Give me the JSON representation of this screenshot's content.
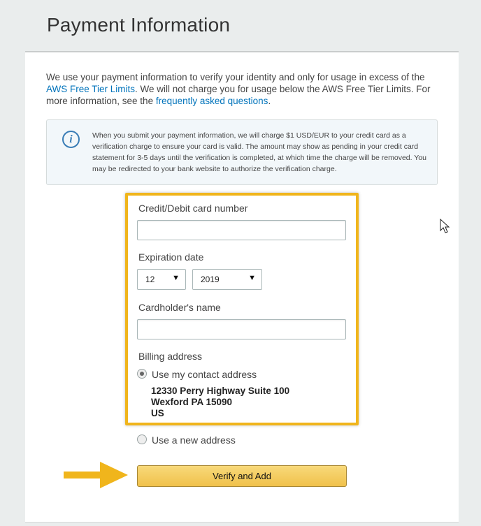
{
  "page": {
    "title": "Payment Information"
  },
  "intro": {
    "text_1": "We use your payment information to verify your identity and only for usage in excess of the ",
    "link_free_tier": "AWS Free Tier Limits",
    "text_2": ". We will not charge you for usage below the AWS Free Tier Limits. For more information, see the ",
    "link_faq": "frequently asked questions",
    "text_3": "."
  },
  "notice": {
    "icon": "i",
    "text": "When you submit your payment information, we will charge $1 USD/EUR to your credit card as a verification charge to ensure your card is valid. The amount may show as pending in your credit card statement for 3-5 days until the verification is completed, at which time the charge will be removed. You may be redirected to your bank website to authorize the verification charge."
  },
  "form": {
    "card_number_label": "Credit/Debit card number",
    "card_number_value": "",
    "expiration_label": "Expiration date",
    "expiration_month": "12",
    "expiration_year": "2019",
    "cardholder_label": "Cardholder's name",
    "cardholder_value": "",
    "billing_label": "Billing address",
    "use_contact_label": "Use my contact address",
    "use_contact_selected": true,
    "address_line_1": "12330 Perry Highway Suite 100",
    "address_line_2": "Wexford PA 15090",
    "address_line_3": "US",
    "use_new_label": "Use a new address",
    "use_new_selected": false
  },
  "actions": {
    "verify_label": "Verify and Add"
  },
  "colors": {
    "highlight": "#f0b51c",
    "link": "#0073bb",
    "button": "#f0c14b"
  },
  "icons": {
    "info": "info-icon",
    "select_caret": "caret-down-icon",
    "pointer": "arrow-right-icon",
    "cursor": "mouse-cursor-icon"
  }
}
